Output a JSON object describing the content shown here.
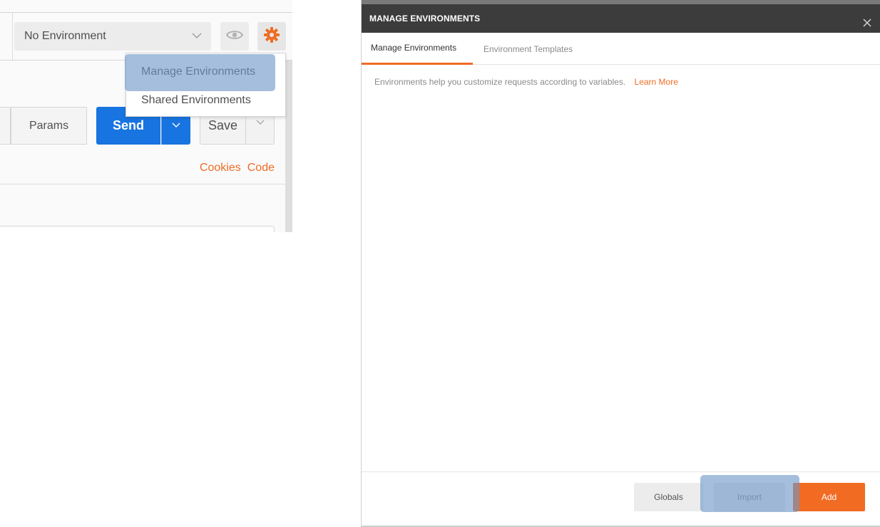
{
  "environment_bar": {
    "selected_environment": "No Environment",
    "icons": {
      "dropdown": "chevron-down-icon",
      "quick_look": "eye-icon",
      "settings": "gear-icon"
    }
  },
  "settings_menu": {
    "items": [
      {
        "label": "Manage Environments",
        "highlighted": true
      },
      {
        "label": "Shared Environments",
        "highlighted": false
      }
    ]
  },
  "request_bar": {
    "params_label": "Params",
    "send_label": "Send",
    "save_label": "Save",
    "links": {
      "cookies": "Cookies",
      "code": "Code"
    }
  },
  "modal": {
    "title": "MANAGE ENVIRONMENTS",
    "close_icon": "close-icon",
    "tabs": [
      {
        "label": "Manage Environments",
        "active": true
      },
      {
        "label": "Environment Templates",
        "active": false
      }
    ],
    "description": "Environments help you customize requests according to variables.",
    "learn_more": "Learn More",
    "footer": {
      "globals_label": "Globals",
      "import_label": "Import",
      "add_label": "Add"
    }
  },
  "colors": {
    "accent_orange": "#ef6c24",
    "send_blue": "#1874e0",
    "highlight_overlay": "#6e96c8",
    "modal_header": "#3c3c3c"
  }
}
